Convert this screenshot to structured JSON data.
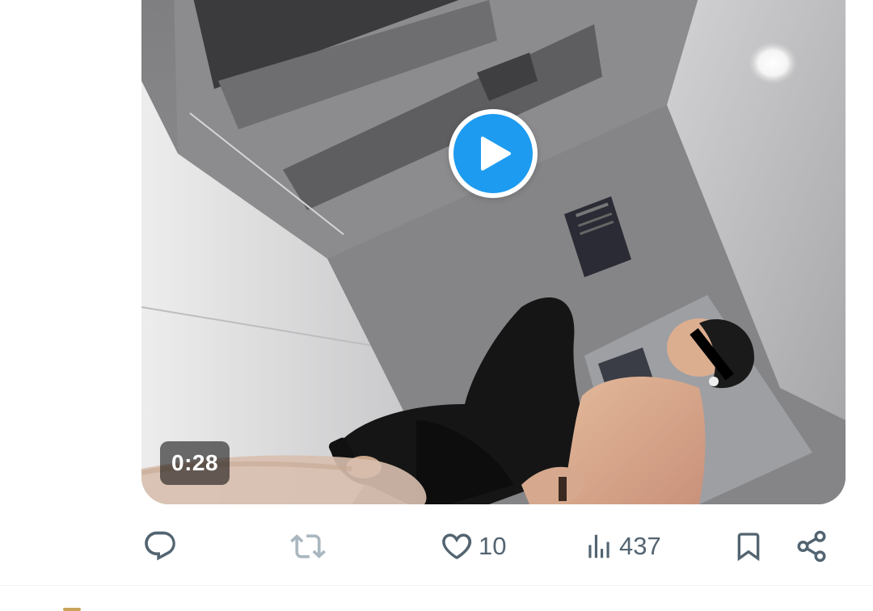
{
  "tweet": {
    "media": {
      "type": "video",
      "duration": "0:28"
    },
    "actions": {
      "reply": {
        "icon": "reply-icon",
        "count": ""
      },
      "repost": {
        "icon": "repost-icon",
        "count": ""
      },
      "like": {
        "icon": "heart-icon",
        "count": "10"
      },
      "views": {
        "icon": "views-icon",
        "count": "437"
      },
      "bookmark": {
        "icon": "bookmark-icon"
      },
      "share": {
        "icon": "share-icon"
      }
    }
  },
  "colors": {
    "accent": "#1d9bf0",
    "icon_gray": "#536471",
    "repost_disabled": "#a9b7c0",
    "divider": "#eff3f4"
  }
}
